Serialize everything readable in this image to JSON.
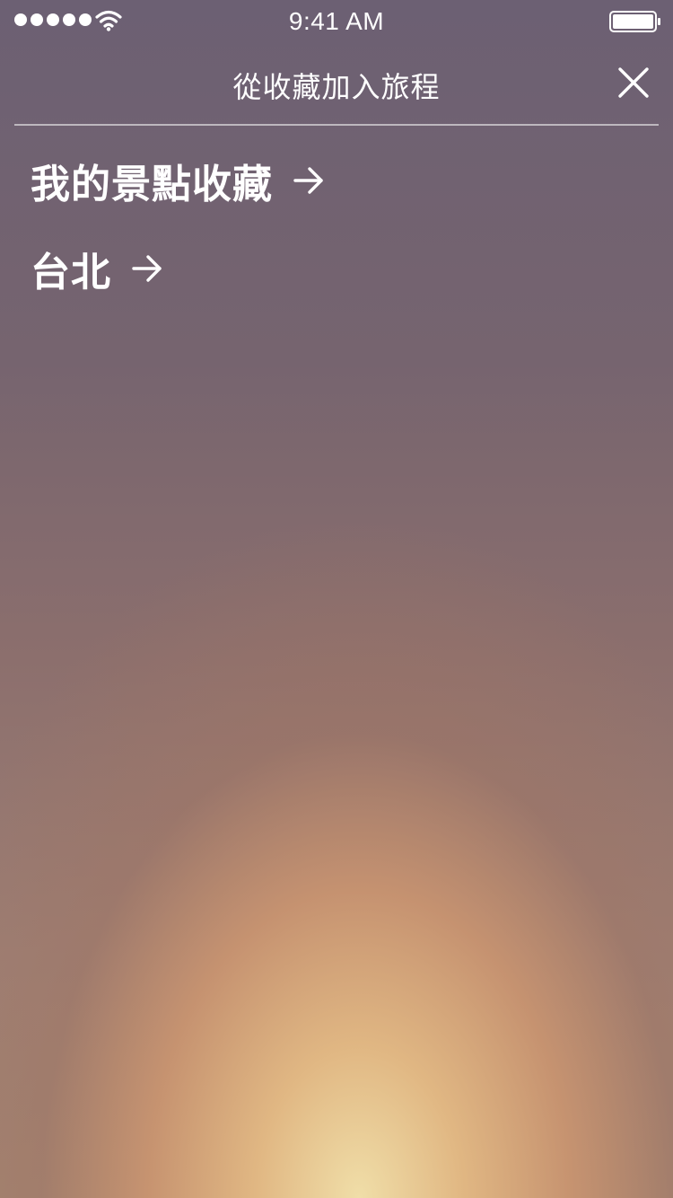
{
  "status_bar": {
    "time": "9:41 AM",
    "signal_dots": 5,
    "icons": [
      "signal-dots-icon",
      "wifi-icon",
      "battery-icon"
    ]
  },
  "nav": {
    "title": "從收藏加入旅程",
    "close_icon": "close-icon"
  },
  "folders": [
    {
      "label": "我的景點收藏",
      "icon": "arrow-right-icon"
    },
    {
      "label": "台北",
      "icon": "arrow-right-icon"
    }
  ],
  "colors": {
    "text": "#ffffff",
    "bg_top": "#6c6073",
    "bg_glow": "#f0dea8"
  }
}
